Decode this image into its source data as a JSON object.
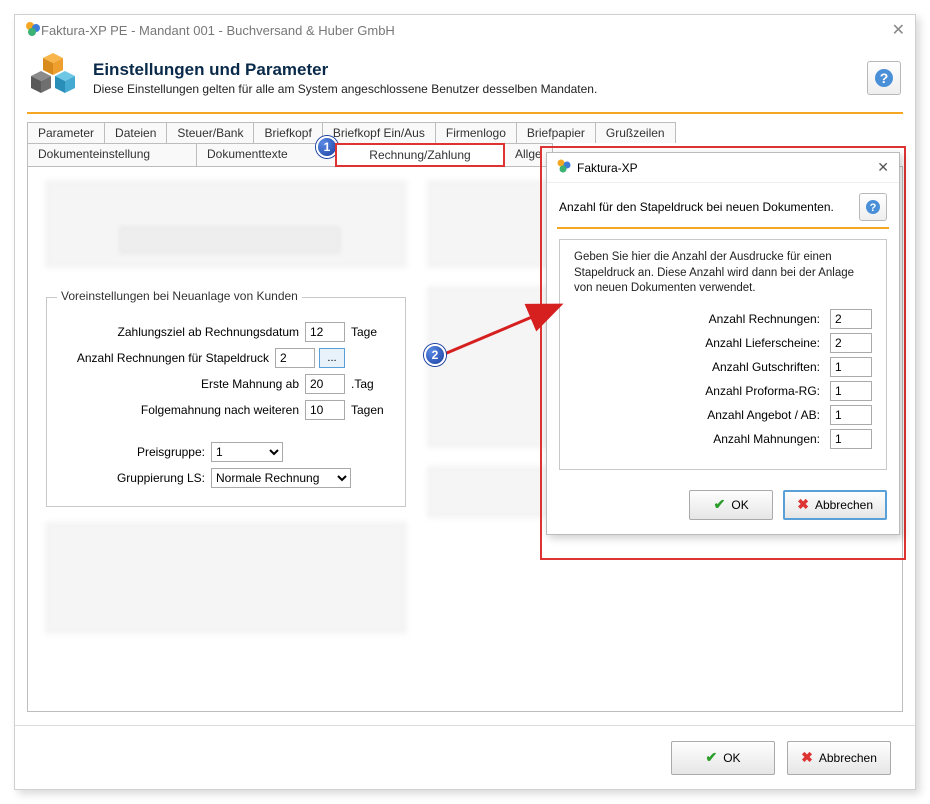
{
  "window": {
    "title": "Faktura-XP PE - Mandant 001 - Buchversand & Huber GmbH"
  },
  "header": {
    "title": "Einstellungen und Parameter",
    "subtitle": "Diese Einstellungen gelten für alle am System angeschlossene Benutzer desselben Mandaten."
  },
  "tabs_row1": {
    "parameter": "Parameter",
    "dateien": "Dateien",
    "steuer_bank": "Steuer/Bank",
    "briefkopf": "Briefkopf",
    "briefkopf_ein_aus": "Briefkopf Ein/Aus",
    "firmenlogo": "Firmenlogo",
    "briefpapier": "Briefpapier",
    "grusszeilen": "Grußzeilen"
  },
  "tabs_row2": {
    "dokumenteinstellung": "Dokumenteinstellung",
    "dokumenttexte": "Dokumenttexte",
    "rechnung_zahlung": "Rechnung/Zahlung",
    "allgemein": "Allge"
  },
  "group": {
    "legend": "Voreinstellungen bei Neuanlage von Kunden",
    "zahlungsziel_label": "Zahlungsziel ab Rechnungsdatum",
    "zahlungsziel_value": "12",
    "zahlungsziel_unit": "Tage",
    "anzahl_label": "Anzahl Rechnungen für Stapeldruck",
    "anzahl_value": "2",
    "browse": "...",
    "erste_mahnung_label": "Erste Mahnung ab",
    "erste_mahnung_value": "20",
    "erste_mahnung_unit": ".Tag",
    "folge_label": "Folgemahnung nach weiteren",
    "folge_value": "10",
    "folge_unit": "Tagen",
    "preisgruppe_label": "Preisgruppe:",
    "preisgruppe_value": "1",
    "gruppierung_label": "Gruppierung LS:",
    "gruppierung_value": "Normale Rechnung"
  },
  "buttons": {
    "ok": "OK",
    "cancel": "Abbrechen"
  },
  "popup": {
    "title": "Faktura-XP",
    "subtitle": "Anzahl für den Stapeldruck bei neuen Dokumenten.",
    "body_intro": "Geben Sie hier die Anzahl der Ausdrucke für einen Stapeldruck an. Diese Anzahl wird dann bei der Anlage von neuen Dokumenten verwendet.",
    "rows": {
      "rechnungen_label": "Anzahl Rechnungen:",
      "rechnungen_value": "2",
      "lieferscheine_label": "Anzahl Lieferscheine:",
      "lieferscheine_value": "2",
      "gutschriften_label": "Anzahl Gutschriften:",
      "gutschriften_value": "1",
      "proforma_label": "Anzahl Proforma-RG:",
      "proforma_value": "1",
      "angebot_label": "Anzahl Angebot / AB:",
      "angebot_value": "1",
      "mahnungen_label": "Anzahl Mahnungen:",
      "mahnungen_value": "1"
    },
    "ok": "OK",
    "cancel": "Abbrechen"
  },
  "callouts": {
    "one": "1",
    "two": "2"
  }
}
